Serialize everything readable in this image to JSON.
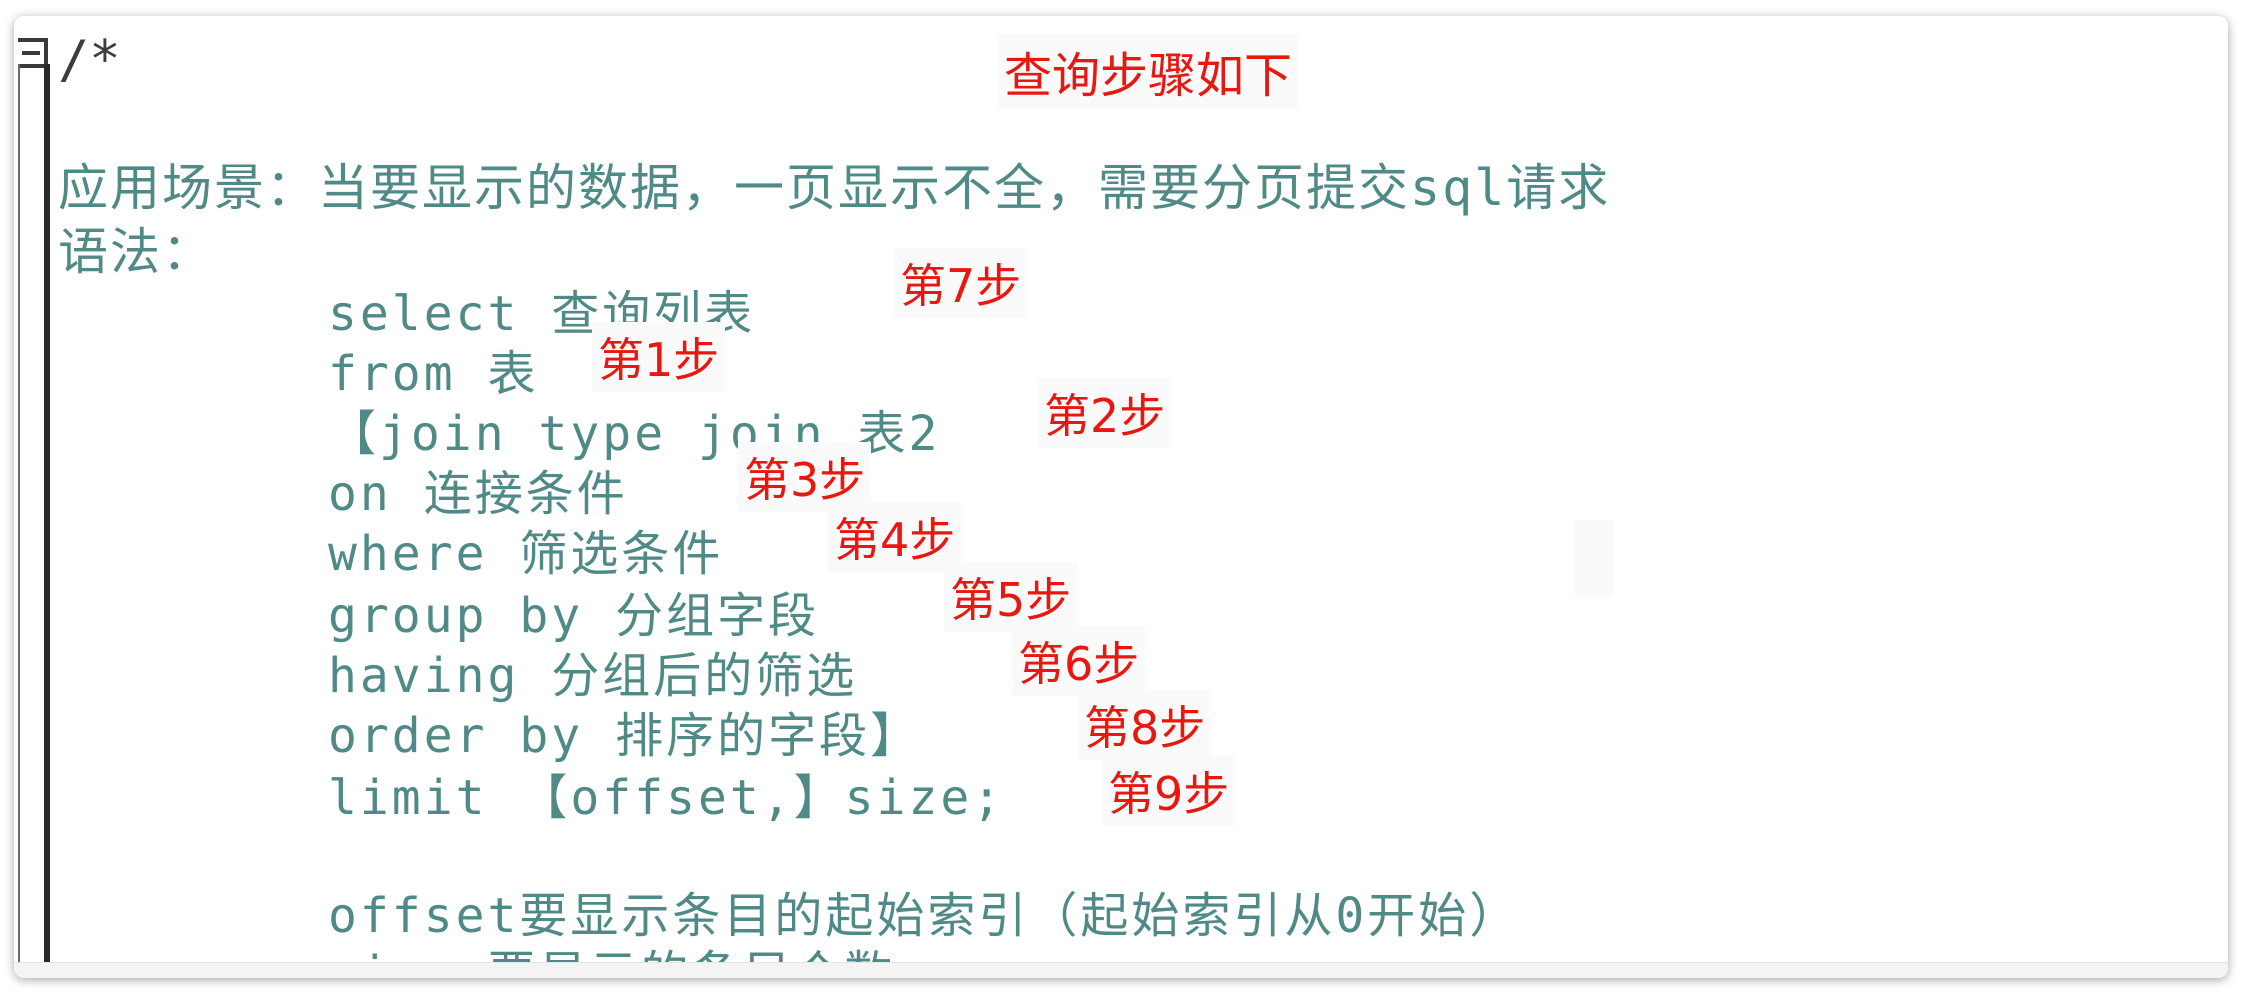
{
  "title": "查询步骤如下",
  "code": {
    "comment_open": "/*",
    "scenario": "应用场景：当要显示的数据，一页显示不全，需要分页提交sql请求",
    "syntax_label": "语法：",
    "lines": [
      "select 查询列表",
      "from 表",
      "【join type join 表2",
      "on 连接条件",
      "where 筛选条件",
      "group by 分组字段",
      "having 分组后的筛选",
      "order by 排序的字段】",
      "limit 【offset,】size;"
    ],
    "offset_note": "offset要显示条目的起始索引（起始索引从0开始）",
    "size_note": "size 要显示的条目个数"
  },
  "annotations": [
    "第7步",
    "第1步",
    "第2步",
    "第3步",
    "第4步",
    "第5步",
    "第6步",
    "第8步",
    "第9步"
  ],
  "colors": {
    "code_text": "#4f8a86",
    "annotation": "#e8170f",
    "gutter": "#2a2a2a"
  }
}
